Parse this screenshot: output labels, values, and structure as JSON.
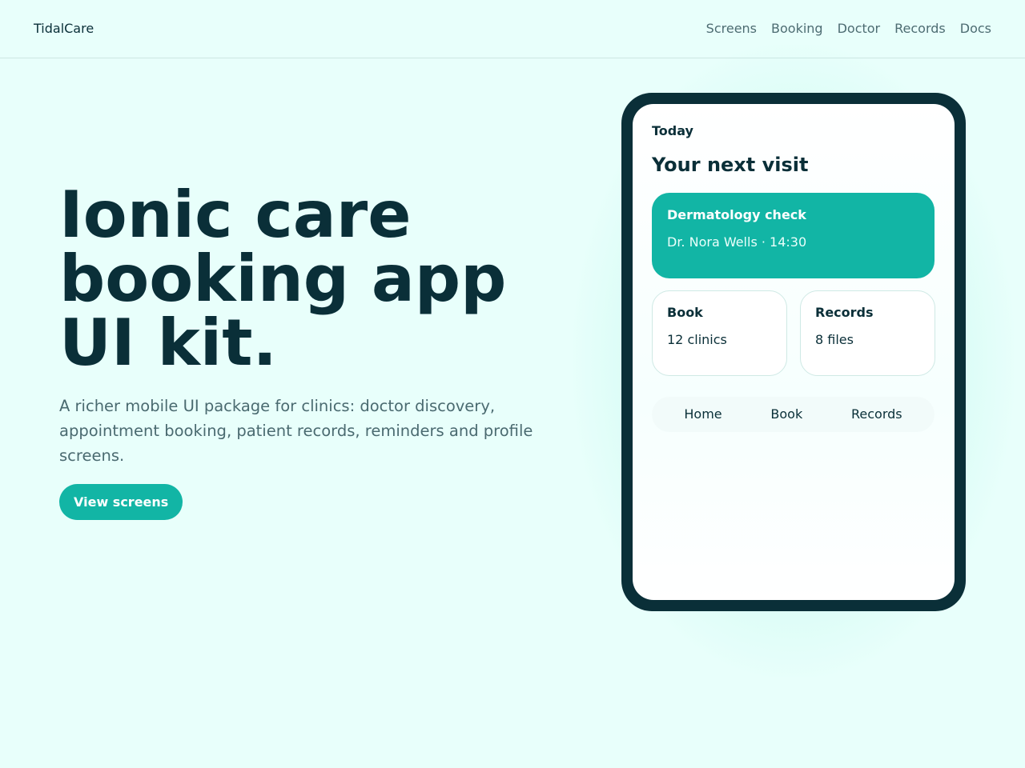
{
  "header": {
    "brand": "TidalCare",
    "nav": [
      "Screens",
      "Booking",
      "Doctor",
      "Records",
      "Docs"
    ]
  },
  "hero": {
    "title": "Ionic care booking app UI kit.",
    "subtitle": "A richer mobile UI package for clinics: doctor discovery, appointment booking, patient records, reminders and profile screens.",
    "cta_label": "View screens"
  },
  "phone": {
    "eyebrow": "Today",
    "heading": "Your next visit",
    "visit": {
      "title": "Dermatology check",
      "meta": "Dr. Nora Wells · 14:30"
    },
    "tiles": [
      {
        "title": "Book",
        "sub": "12 clinics"
      },
      {
        "title": "Records",
        "sub": "8 files"
      }
    ],
    "tabs": [
      "Home",
      "Book",
      "Records"
    ]
  },
  "colors": {
    "background": "#e8fffb",
    "accent": "#12b5a5",
    "ink": "#0a2f38",
    "muted": "#4a6a70"
  }
}
